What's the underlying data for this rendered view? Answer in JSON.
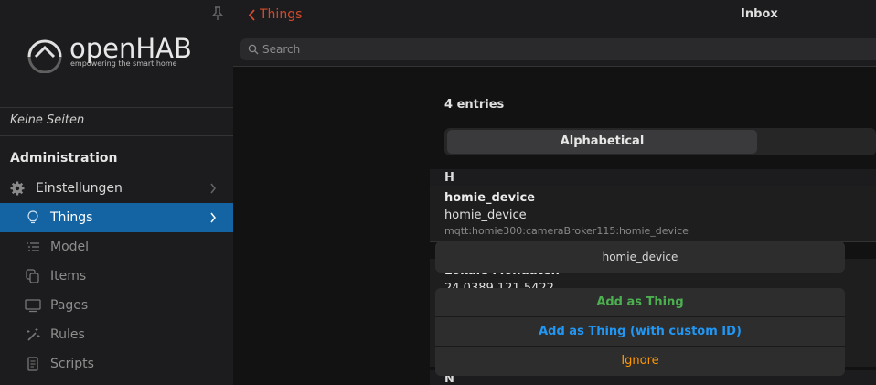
{
  "sidebar": {
    "logo_word": "openHAB",
    "logo_tagline": "empowering the smart home",
    "no_pages": "Keine Seiten",
    "section_title": "Administration",
    "items": [
      {
        "label": "Einstellungen",
        "icon": "gear-icon"
      },
      {
        "label": "Things",
        "icon": "lightbulb-icon"
      },
      {
        "label": "Model",
        "icon": "list-icon"
      },
      {
        "label": "Items",
        "icon": "copy-icon"
      },
      {
        "label": "Pages",
        "icon": "monitor-icon"
      },
      {
        "label": "Rules",
        "icon": "magic-wand-icon"
      },
      {
        "label": "Scripts",
        "icon": "document-icon"
      }
    ]
  },
  "topbar": {
    "back_label": "Things",
    "title": "Inbox",
    "search_placeholder": "Search"
  },
  "main": {
    "entries": "4 entries",
    "sort_label": "Alphabetical",
    "groups": [
      {
        "letter": "H"
      },
      {
        "letter": "N"
      }
    ],
    "items": [
      {
        "title": "homie_device",
        "subtitle": "homie_device",
        "footer": "mqtt:homie300:cameraBroker115:homie_device"
      },
      {
        "title": "Lokale Mondaten",
        "subtitle": "24.0389 121.5422"
      }
    ]
  },
  "action_sheet": {
    "label": "homie_device",
    "add_thing": "Add as Thing",
    "add_custom": "Add as Thing (with custom ID)",
    "ignore": "Ignore"
  },
  "colors": {
    "accent": "#1464a3",
    "back_link": "#d34a2c",
    "add": "#4caf50",
    "add_custom": "#2196f3",
    "ignore": "#ff9800"
  }
}
